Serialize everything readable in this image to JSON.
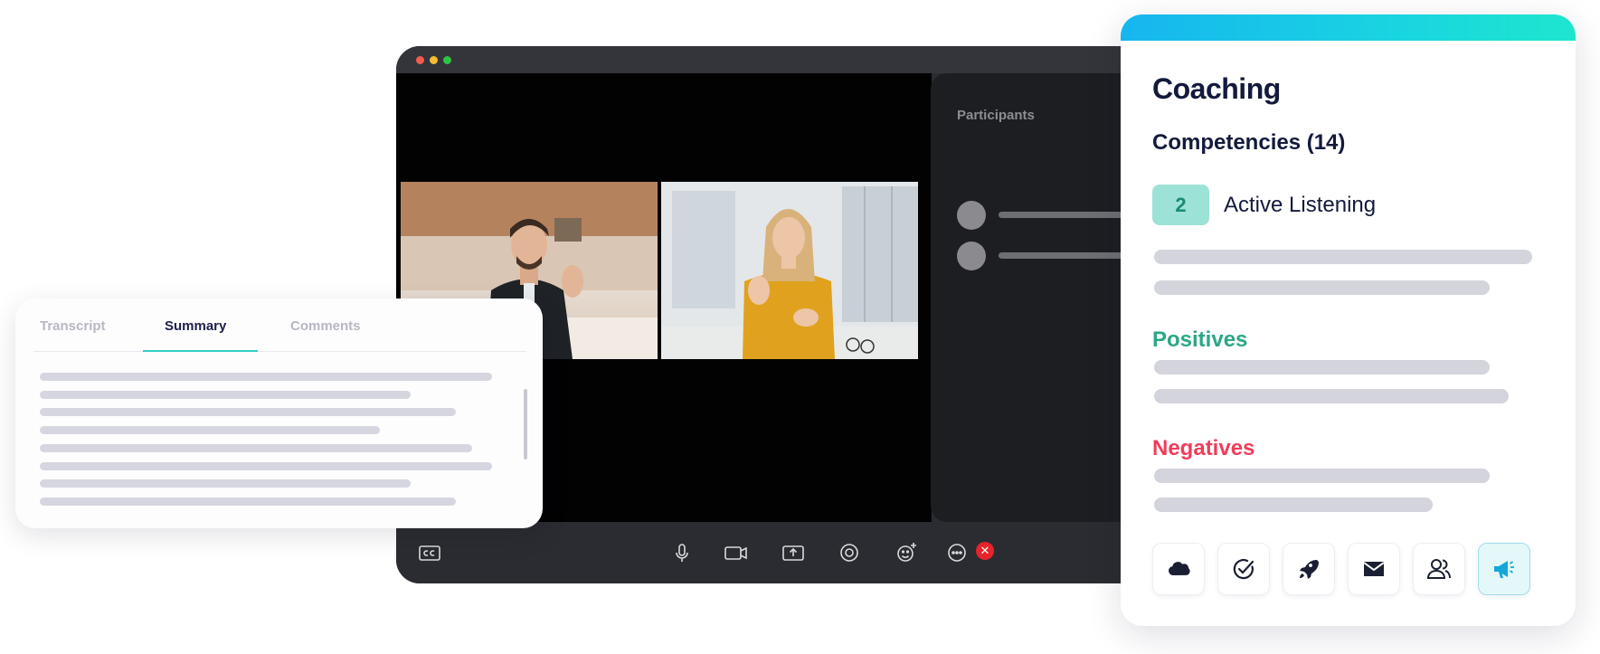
{
  "transcript_card": {
    "tabs": [
      {
        "label": "Transcript",
        "active": false
      },
      {
        "label": "Summary",
        "active": true
      },
      {
        "label": "Comments",
        "active": false
      }
    ]
  },
  "call": {
    "participants_title": "Participants",
    "toolbar_icons": [
      "closed-captions-icon",
      "microphone-icon",
      "camera-icon",
      "share-screen-icon",
      "record-icon",
      "add-reaction-icon",
      "more-icon",
      "end-call-icon"
    ],
    "end_call_glyph": "✕"
  },
  "coaching": {
    "title": "Coaching",
    "competencies_title": "Competencies (14)",
    "badge_value": "2",
    "competency_name": "Active Listening",
    "positives_title": "Positives",
    "negatives_title": "Negatives",
    "action_icons": [
      "salesforce-cloud-icon",
      "check-circle-icon",
      "rocket-icon",
      "mail-icon",
      "users-icon",
      "megaphone-icon"
    ],
    "active_icon": "megaphone-icon"
  },
  "colors": {
    "accent_teal": "#2fd1c4",
    "positive_green": "#2ba788",
    "negative_red": "#f03d5a",
    "brand_dark": "#131a3c"
  }
}
